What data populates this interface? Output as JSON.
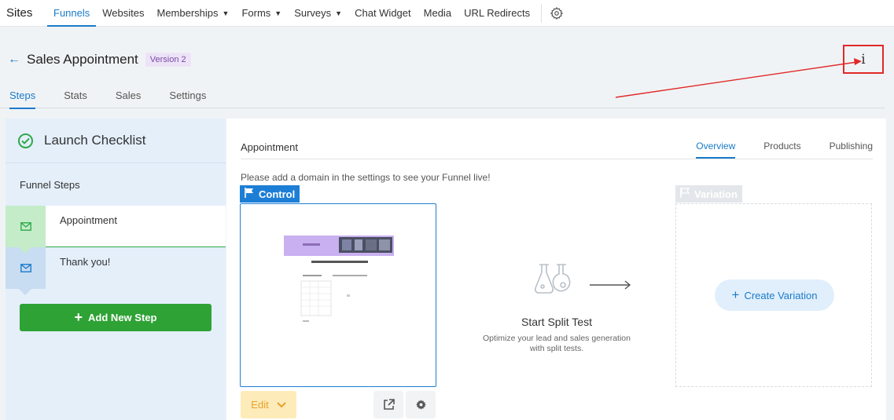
{
  "topnav": {
    "brand": "Sites",
    "items": [
      {
        "label": "Funnels",
        "active": true
      },
      {
        "label": "Websites"
      },
      {
        "label": "Memberships",
        "caret": true
      },
      {
        "label": "Forms",
        "caret": true
      },
      {
        "label": "Surveys",
        "caret": true
      },
      {
        "label": "Chat Widget"
      },
      {
        "label": "Media"
      },
      {
        "label": "URL Redirects"
      }
    ],
    "settings_icon": "gear-icon"
  },
  "header": {
    "back_icon": "arrow-left-icon",
    "title": "Sales Appointment",
    "version": "Version 2"
  },
  "subtabs": [
    "Steps",
    "Stats",
    "Sales",
    "Settings"
  ],
  "info": {
    "glyph": "i"
  },
  "left": {
    "checklist_label": "Launch Checklist",
    "section_label": "Funnel Steps",
    "steps": [
      {
        "label": "Appointment",
        "icon": "mail-icon",
        "active": true
      },
      {
        "label": "Thank you!",
        "icon": "mail-icon"
      }
    ],
    "add_step": "Add New Step"
  },
  "main": {
    "step_name": "Appointment",
    "tabs": [
      "Overview",
      "Products",
      "Publishing"
    ],
    "domain_note": "Please add a domain in the settings to see your Funnel live!",
    "control_label": "Control",
    "edit_label": "Edit",
    "split_title": "Start Split Test",
    "split_desc": "Optimize your lead and sales generation with split tests.",
    "variation_label": "Variation",
    "create_variation": "Create Variation"
  },
  "colors": {
    "accent": "#1a7bc9",
    "green": "#2fa235",
    "annotation": "#e12828"
  }
}
